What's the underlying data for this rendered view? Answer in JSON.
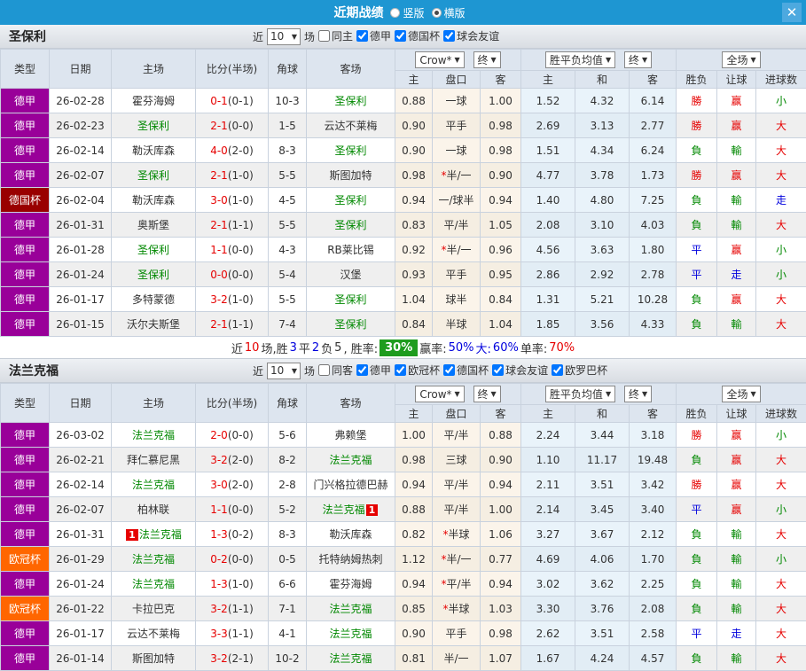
{
  "titlebar": {
    "title": "近期战绩",
    "radio_vertical": "竖版",
    "radio_horizontal": "横版",
    "close_glyph": "✕"
  },
  "header": {
    "col_type": "类型",
    "col_date": "日期",
    "col_home": "主场",
    "col_score": "比分(半场)",
    "col_corners": "角球",
    "col_away": "客场",
    "dd_company": "Crow*",
    "dd_final1": "终",
    "dd_avg": "胜平负均值",
    "dd_final2": "终",
    "dd_fulltime": "全场",
    "sub_home": "主",
    "sub_handicap": "盘口",
    "sub_away": "客",
    "sub_avg_home": "主",
    "sub_avg_draw": "和",
    "sub_avg_away": "客",
    "sub_result": "胜负",
    "sub_handicap_result": "让球",
    "sub_goals": "进球数"
  },
  "league_colors": {
    "德甲": "#990099",
    "德国杯": "#990000",
    "欧冠杯": "#ff6600"
  },
  "result_colors": {
    "勝": "#e60000",
    "赢": "#e60000",
    "大": "#e60000",
    "負": "#008800",
    "輸": "#008800",
    "小": "#008800",
    "平": "#0000dd",
    "走": "#0000dd"
  },
  "sections": [
    {
      "team": "圣保利",
      "filter": {
        "near_label": "近",
        "games_value": "10",
        "games_label": "场",
        "checkboxes": [
          {
            "label": "同主",
            "checked": false
          },
          {
            "label": "德甲",
            "checked": true
          },
          {
            "label": "德国杯",
            "checked": true
          },
          {
            "label": "球会友谊",
            "checked": true
          }
        ]
      },
      "rows": [
        {
          "type": "德甲",
          "date": "26-02-28",
          "home": {
            "name": "霍芬海姆"
          },
          "score": "0-1",
          "half": "(0-1)",
          "corners": "10-3",
          "away": {
            "name": "圣保利",
            "self": true
          },
          "o1": "0.88",
          "hc": {
            "star": false,
            "text": "一球"
          },
          "o2": "1.00",
          "a1": "1.52",
          "a2": "4.32",
          "a3": "6.14",
          "r": [
            "勝",
            "赢",
            "小"
          ]
        },
        {
          "type": "德甲",
          "date": "26-02-23",
          "home": {
            "name": "圣保利",
            "self": true
          },
          "score": "2-1",
          "half": "(0-0)",
          "corners": "1-5",
          "away": {
            "name": "云达不莱梅"
          },
          "o1": "0.90",
          "hc": {
            "star": false,
            "text": "平手"
          },
          "o2": "0.98",
          "a1": "2.69",
          "a2": "3.13",
          "a3": "2.77",
          "r": [
            "勝",
            "赢",
            "大"
          ]
        },
        {
          "type": "德甲",
          "date": "26-02-14",
          "home": {
            "name": "勒沃库森"
          },
          "score": "4-0",
          "half": "(2-0)",
          "corners": "8-3",
          "away": {
            "name": "圣保利",
            "self": true
          },
          "o1": "0.90",
          "hc": {
            "star": false,
            "text": "一球"
          },
          "o2": "0.98",
          "a1": "1.51",
          "a2": "4.34",
          "a3": "6.24",
          "r": [
            "負",
            "輸",
            "大"
          ]
        },
        {
          "type": "德甲",
          "date": "26-02-07",
          "home": {
            "name": "圣保利",
            "self": true
          },
          "score": "2-1",
          "half": "(1-0)",
          "corners": "5-5",
          "away": {
            "name": "斯图加特"
          },
          "o1": "0.98",
          "hc": {
            "star": true,
            "text": "半/一"
          },
          "o2": "0.90",
          "a1": "4.77",
          "a2": "3.78",
          "a3": "1.73",
          "r": [
            "勝",
            "赢",
            "大"
          ]
        },
        {
          "type": "德国杯",
          "date": "26-02-04",
          "home": {
            "name": "勒沃库森"
          },
          "score": "3-0",
          "half": "(1-0)",
          "corners": "4-5",
          "away": {
            "name": "圣保利",
            "self": true
          },
          "o1": "0.94",
          "hc": {
            "star": false,
            "text": "一/球半"
          },
          "o2": "0.94",
          "a1": "1.40",
          "a2": "4.80",
          "a3": "7.25",
          "r": [
            "負",
            "輸",
            "走"
          ]
        },
        {
          "type": "德甲",
          "date": "26-01-31",
          "home": {
            "name": "奥斯堡"
          },
          "score": "2-1",
          "half": "(1-1)",
          "corners": "5-5",
          "away": {
            "name": "圣保利",
            "self": true
          },
          "o1": "0.83",
          "hc": {
            "star": false,
            "text": "平/半"
          },
          "o2": "1.05",
          "a1": "2.08",
          "a2": "3.10",
          "a3": "4.03",
          "r": [
            "負",
            "輸",
            "大"
          ]
        },
        {
          "type": "德甲",
          "date": "26-01-28",
          "home": {
            "name": "圣保利",
            "self": true
          },
          "score": "1-1",
          "half": "(0-0)",
          "corners": "4-3",
          "away": {
            "name": "RB莱比锡"
          },
          "o1": "0.92",
          "hc": {
            "star": true,
            "text": "半/一"
          },
          "o2": "0.96",
          "a1": "4.56",
          "a2": "3.63",
          "a3": "1.80",
          "r": [
            "平",
            "赢",
            "小"
          ]
        },
        {
          "type": "德甲",
          "date": "26-01-24",
          "home": {
            "name": "圣保利",
            "self": true
          },
          "score": "0-0",
          "half": "(0-0)",
          "corners": "5-4",
          "away": {
            "name": "汉堡"
          },
          "o1": "0.93",
          "hc": {
            "star": false,
            "text": "平手"
          },
          "o2": "0.95",
          "a1": "2.86",
          "a2": "2.92",
          "a3": "2.78",
          "r": [
            "平",
            "走",
            "小"
          ]
        },
        {
          "type": "德甲",
          "date": "26-01-17",
          "home": {
            "name": "多特蒙德"
          },
          "score": "3-2",
          "half": "(1-0)",
          "corners": "5-5",
          "away": {
            "name": "圣保利",
            "self": true
          },
          "o1": "1.04",
          "hc": {
            "star": false,
            "text": "球半"
          },
          "o2": "0.84",
          "a1": "1.31",
          "a2": "5.21",
          "a3": "10.28",
          "r": [
            "負",
            "赢",
            "大"
          ]
        },
        {
          "type": "德甲",
          "date": "26-01-15",
          "home": {
            "name": "沃尔夫斯堡"
          },
          "score": "2-1",
          "half": "(1-1)",
          "corners": "7-4",
          "away": {
            "name": "圣保利",
            "self": true
          },
          "o1": "0.84",
          "hc": {
            "star": false,
            "text": "半球"
          },
          "o2": "1.04",
          "a1": "1.85",
          "a2": "3.56",
          "a3": "4.33",
          "r": [
            "負",
            "輸",
            "大"
          ]
        }
      ],
      "summary": [
        {
          "text": "近",
          "c": "#333333"
        },
        {
          "text": "10",
          "c": "#e60000"
        },
        {
          "text": "场,胜",
          "c": "#333333"
        },
        {
          "text": "3",
          "c": "#0000dd"
        },
        {
          "text": "平",
          "c": "#333333"
        },
        {
          "text": "2",
          "c": "#0000dd"
        },
        {
          "text": "负",
          "c": "#333333"
        },
        {
          "text": "5",
          "c": "#333333"
        },
        {
          "text": ", 胜率:",
          "c": "#333333"
        },
        {
          "text": "30%",
          "badge": true
        },
        {
          "text": "赢率:",
          "c": "#333333"
        },
        {
          "text": "50%",
          "c": "#0000dd"
        },
        {
          "text": " 大:",
          "c": "#0000dd"
        },
        {
          "text": "60%",
          "c": "#0000dd"
        },
        {
          "text": " 单率:",
          "c": "#333333"
        },
        {
          "text": "70%",
          "c": "#e60000"
        }
      ]
    },
    {
      "team": "法兰克福",
      "filter": {
        "near_label": "近",
        "games_value": "10",
        "games_label": "场",
        "checkboxes": [
          {
            "label": "同客",
            "checked": false
          },
          {
            "label": "德甲",
            "checked": true
          },
          {
            "label": "欧冠杯",
            "checked": true
          },
          {
            "label": "德国杯",
            "checked": true
          },
          {
            "label": "球会友谊",
            "checked": true
          },
          {
            "label": "欧罗巴杯",
            "checked": true
          }
        ]
      },
      "rows": [
        {
          "type": "德甲",
          "date": "26-03-02",
          "home": {
            "name": "法兰克福",
            "self": true
          },
          "score": "2-0",
          "half": "(0-0)",
          "corners": "5-6",
          "away": {
            "name": "弗赖堡"
          },
          "o1": "1.00",
          "hc": {
            "star": false,
            "text": "平/半"
          },
          "o2": "0.88",
          "a1": "2.24",
          "a2": "3.44",
          "a3": "3.18",
          "r": [
            "勝",
            "赢",
            "小"
          ]
        },
        {
          "type": "德甲",
          "date": "26-02-21",
          "home": {
            "name": "拜仁慕尼黑"
          },
          "score": "3-2",
          "half": "(2-0)",
          "corners": "8-2",
          "away": {
            "name": "法兰克福",
            "self": true
          },
          "o1": "0.98",
          "hc": {
            "star": false,
            "text": "三球"
          },
          "o2": "0.90",
          "a1": "1.10",
          "a2": "11.17",
          "a3": "19.48",
          "r": [
            "負",
            "赢",
            "大"
          ]
        },
        {
          "type": "德甲",
          "date": "26-02-14",
          "home": {
            "name": "法兰克福",
            "self": true
          },
          "score": "3-0",
          "half": "(2-0)",
          "corners": "2-8",
          "away": {
            "name": "门兴格拉德巴赫"
          },
          "o1": "0.94",
          "hc": {
            "star": false,
            "text": "平/半"
          },
          "o2": "0.94",
          "a1": "2.11",
          "a2": "3.51",
          "a3": "3.42",
          "r": [
            "勝",
            "赢",
            "大"
          ]
        },
        {
          "type": "德甲",
          "date": "26-02-07",
          "home": {
            "name": "柏林联"
          },
          "score": "1-1",
          "half": "(0-0)",
          "corners": "5-2",
          "away": {
            "name": "法兰克福",
            "self": true,
            "badge": "1",
            "badge_pos": "after"
          },
          "o1": "0.88",
          "hc": {
            "star": false,
            "text": "平/半"
          },
          "o2": "1.00",
          "a1": "2.14",
          "a2": "3.45",
          "a3": "3.40",
          "r": [
            "平",
            "赢",
            "小"
          ]
        },
        {
          "type": "德甲",
          "date": "26-01-31",
          "home": {
            "name": "法兰克福",
            "self": true,
            "badge": "1",
            "badge_pos": "before"
          },
          "score": "1-3",
          "half": "(0-2)",
          "corners": "8-3",
          "away": {
            "name": "勒沃库森"
          },
          "o1": "0.82",
          "hc": {
            "star": true,
            "text": "半球"
          },
          "o2": "1.06",
          "a1": "3.27",
          "a2": "3.67",
          "a3": "2.12",
          "r": [
            "負",
            "輸",
            "大"
          ]
        },
        {
          "type": "欧冠杯",
          "date": "26-01-29",
          "home": {
            "name": "法兰克福",
            "self": true
          },
          "score": "0-2",
          "half": "(0-0)",
          "corners": "0-5",
          "away": {
            "name": "托特纳姆热刺"
          },
          "o1": "1.12",
          "hc": {
            "star": true,
            "text": "半/一"
          },
          "o2": "0.77",
          "a1": "4.69",
          "a2": "4.06",
          "a3": "1.70",
          "r": [
            "負",
            "輸",
            "小"
          ]
        },
        {
          "type": "德甲",
          "date": "26-01-24",
          "home": {
            "name": "法兰克福",
            "self": true
          },
          "score": "1-3",
          "half": "(1-0)",
          "corners": "6-6",
          "away": {
            "name": "霍芬海姆"
          },
          "o1": "0.94",
          "hc": {
            "star": true,
            "text": "平/半"
          },
          "o2": "0.94",
          "a1": "3.02",
          "a2": "3.62",
          "a3": "2.25",
          "r": [
            "負",
            "輸",
            "大"
          ]
        },
        {
          "type": "欧冠杯",
          "date": "26-01-22",
          "home": {
            "name": "卡拉巴克"
          },
          "score": "3-2",
          "half": "(1-1)",
          "corners": "7-1",
          "away": {
            "name": "法兰克福",
            "self": true
          },
          "o1": "0.85",
          "hc": {
            "star": true,
            "text": "半球"
          },
          "o2": "1.03",
          "a1": "3.30",
          "a2": "3.76",
          "a3": "2.08",
          "r": [
            "負",
            "輸",
            "大"
          ]
        },
        {
          "type": "德甲",
          "date": "26-01-17",
          "home": {
            "name": "云达不莱梅"
          },
          "score": "3-3",
          "half": "(1-1)",
          "corners": "4-1",
          "away": {
            "name": "法兰克福",
            "self": true
          },
          "o1": "0.90",
          "hc": {
            "star": false,
            "text": "平手"
          },
          "o2": "0.98",
          "a1": "2.62",
          "a2": "3.51",
          "a3": "2.58",
          "r": [
            "平",
            "走",
            "大"
          ]
        },
        {
          "type": "德甲",
          "date": "26-01-14",
          "home": {
            "name": "斯图加特"
          },
          "score": "3-2",
          "half": "(2-1)",
          "corners": "10-2",
          "away": {
            "name": "法兰克福",
            "self": true
          },
          "o1": "0.81",
          "hc": {
            "star": false,
            "text": "半/一"
          },
          "o2": "1.07",
          "a1": "1.67",
          "a2": "4.24",
          "a3": "4.57",
          "r": [
            "負",
            "輸",
            "大"
          ]
        }
      ],
      "summary": null
    }
  ]
}
